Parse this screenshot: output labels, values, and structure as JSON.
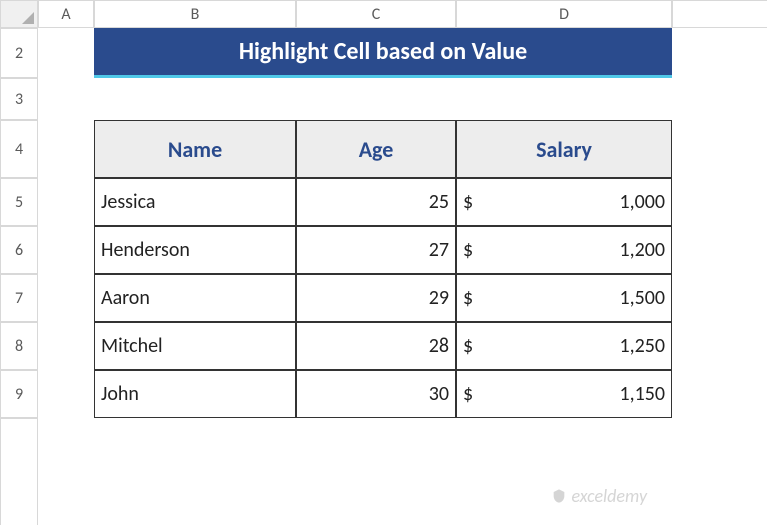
{
  "columns": [
    "A",
    "B",
    "C",
    "D"
  ],
  "rows": [
    "2",
    "3",
    "4",
    "5",
    "6",
    "7",
    "8",
    "9"
  ],
  "title": "Highlight Cell based on Value",
  "headers": {
    "name": "Name",
    "age": "Age",
    "salary": "Salary"
  },
  "data": [
    {
      "name": "Jessica",
      "age": "25",
      "salary": "1,000"
    },
    {
      "name": "Henderson",
      "age": "27",
      "salary": "1,200"
    },
    {
      "name": "Aaron",
      "age": "29",
      "salary": "1,500"
    },
    {
      "name": "Mitchel",
      "age": "28",
      "salary": "1,250"
    },
    {
      "name": "John",
      "age": "30",
      "salary": "1,150"
    }
  ],
  "currency": "$",
  "watermark": "exceldemy",
  "chart_data": {
    "type": "table",
    "title": "Highlight Cell based on Value",
    "categories": [
      "Name",
      "Age",
      "Salary"
    ],
    "series": [
      {
        "name": "Jessica",
        "values": [
          "Jessica",
          25,
          1000
        ]
      },
      {
        "name": "Henderson",
        "values": [
          "Henderson",
          27,
          1200
        ]
      },
      {
        "name": "Aaron",
        "values": [
          "Aaron",
          29,
          1500
        ]
      },
      {
        "name": "Mitchel",
        "values": [
          "Mitchel",
          28,
          1250
        ]
      },
      {
        "name": "John",
        "values": [
          "John",
          30,
          1150
        ]
      }
    ]
  }
}
